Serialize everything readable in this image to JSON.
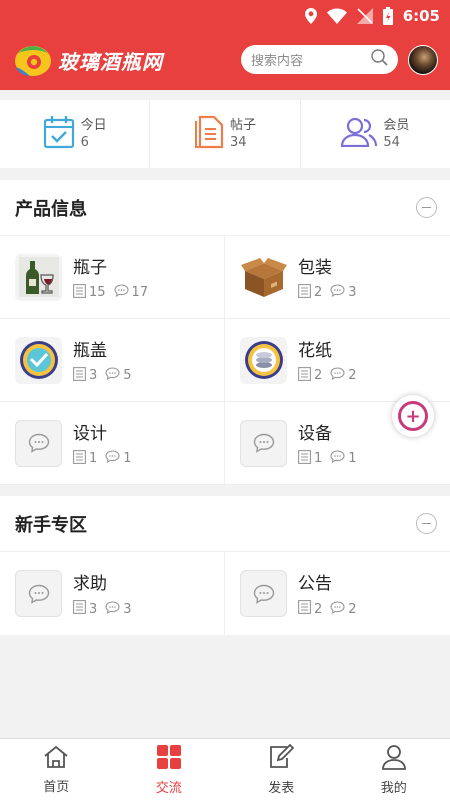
{
  "colors": {
    "brand": "#e8403f",
    "fab": "#c83a7a"
  },
  "status": {
    "time": "6:05"
  },
  "header": {
    "logo_text": "玻璃酒瓶网",
    "search_placeholder": "搜索内容"
  },
  "stats": [
    {
      "label": "今日",
      "value": "6",
      "icon": "calendar-check-icon"
    },
    {
      "label": "帖子",
      "value": "34",
      "icon": "document-icon"
    },
    {
      "label": "会员",
      "value": "54",
      "icon": "members-icon"
    }
  ],
  "sections": [
    {
      "title": "产品信息",
      "items": [
        {
          "name": "瓶子",
          "posts": "15",
          "replies": "17",
          "icon": "bottles-icon"
        },
        {
          "name": "包装",
          "posts": "2",
          "replies": "3",
          "icon": "box-icon"
        },
        {
          "name": "瓶盖",
          "posts": "3",
          "replies": "5",
          "icon": "bottle-cap-icon"
        },
        {
          "name": "花纸",
          "posts": "2",
          "replies": "2",
          "icon": "decal-icon"
        },
        {
          "name": "设计",
          "posts": "1",
          "replies": "1",
          "icon": "chat-bubble-icon"
        },
        {
          "name": "设备",
          "posts": "1",
          "replies": "1",
          "icon": "chat-bubble-icon"
        }
      ]
    },
    {
      "title": "新手专区",
      "items": [
        {
          "name": "求助",
          "posts": "3",
          "replies": "3",
          "icon": "chat-bubble-icon"
        },
        {
          "name": "公告",
          "posts": "2",
          "replies": "2",
          "icon": "chat-bubble-icon"
        }
      ]
    }
  ],
  "nav": [
    {
      "label": "首页",
      "icon": "home-icon",
      "active": false
    },
    {
      "label": "交流",
      "icon": "grid-icon",
      "active": true
    },
    {
      "label": "发表",
      "icon": "compose-icon",
      "active": false
    },
    {
      "label": "我的",
      "icon": "user-icon",
      "active": false
    }
  ]
}
